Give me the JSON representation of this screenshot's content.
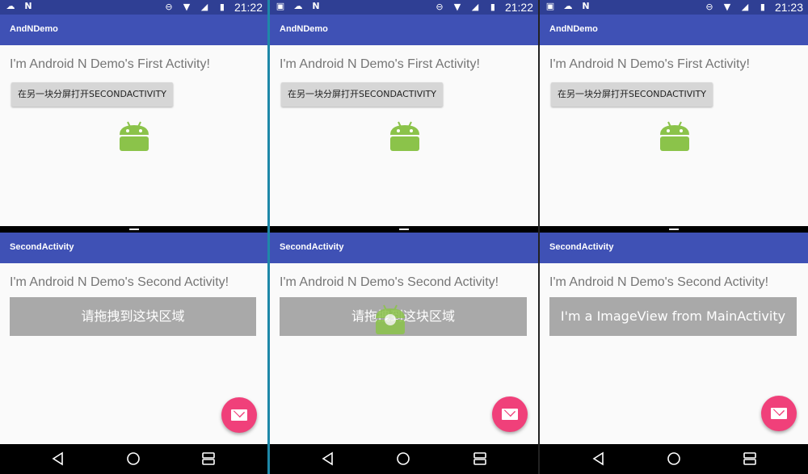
{
  "phones": [
    {
      "status_time": "21:22",
      "app_title": "AndNDemo",
      "first_activity_text": "I'm Android N Demo's First Activity!",
      "open_button_label": "在另一块分屏打开SECONDACTIVITY",
      "second_title": "SecondActivity",
      "second_activity_text": "I'm Android N Demo's Second Activity!",
      "drop_zone_text": "请拖拽到这块区域",
      "fab_icon": "mail-icon"
    },
    {
      "status_time": "21:22",
      "app_title": "AndNDemo",
      "first_activity_text": "I'm Android N Demo's First Activity!",
      "open_button_label": "在另一块分屏打开SECONDACTIVITY",
      "second_title": "SecondActivity",
      "second_activity_text": "I'm Android N Demo's Second Activity!",
      "drop_zone_text": "请拖拽到这块区域",
      "fab_icon": "mail-icon"
    },
    {
      "status_time": "21:23",
      "app_title": "AndNDemo",
      "first_activity_text": "I'm Android N Demo's First Activity!",
      "open_button_label": "在另一块分屏打开SECONDACTIVITY",
      "second_title": "SecondActivity",
      "second_activity_text": "I'm Android N Demo's Second Activity!",
      "drop_zone_text": "I'm a ImageView from MainActivity",
      "fab_icon": "mail-icon"
    }
  ],
  "colors": {
    "status_bar": "#2f3f94",
    "app_bar": "#3f51b5",
    "fab": "#f0407a",
    "android_green": "#8bc34a",
    "drop_zone": "#a9a9a9",
    "separator": "#1e88a8"
  }
}
